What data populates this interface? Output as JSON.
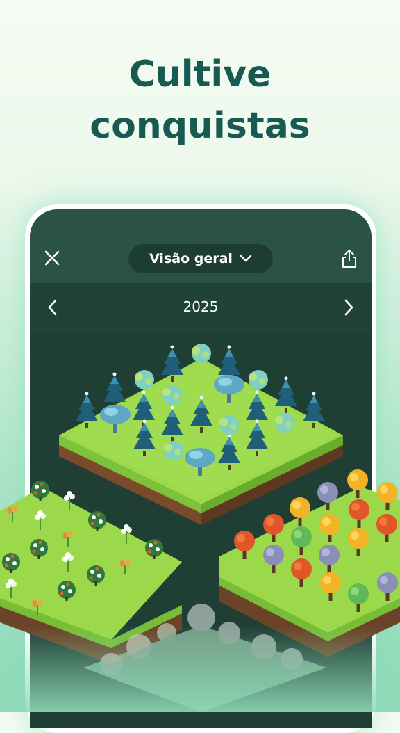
{
  "headline": {
    "line1": "Cultive",
    "line2": "conquistas"
  },
  "app": {
    "close_icon": "close-icon",
    "view_selector": {
      "label": "Visão geral",
      "icon": "chevron-down-icon"
    },
    "share_icon": "share-icon",
    "year_nav": {
      "year": "2025",
      "prev_icon": "chevron-left-icon",
      "next_icon": "chevron-right-icon"
    }
  },
  "illustrations": [
    {
      "name": "forest-plot-2025",
      "content": "coniferous trees and bushes"
    },
    {
      "name": "flower-garden-plot",
      "content": "flower bushes"
    },
    {
      "name": "autumn-tree-plot",
      "content": "autumn trees"
    },
    {
      "name": "faded-plot",
      "content": "white trees"
    }
  ],
  "colors": {
    "headline": "#175a52",
    "screen_bg": "#1f3f35",
    "topbar": "#2b5247",
    "grass": "#8fcf3a",
    "soil": "#7a4a2a"
  }
}
